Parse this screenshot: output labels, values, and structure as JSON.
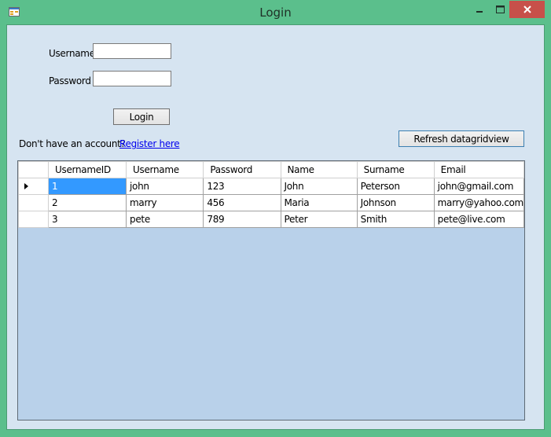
{
  "window": {
    "title": "Login",
    "app_icon": "form-icon",
    "controls": {
      "minimize_icon": "minimize-icon",
      "maximize_icon": "maximize-icon",
      "close_icon": "close-icon"
    },
    "colors": {
      "frame": "#5bbf8c",
      "client": "#d6e4f1",
      "close": "#c7504a",
      "grid_background": "#b9d1ea",
      "selection": "#3399ff"
    }
  },
  "form": {
    "username_label": "Username",
    "username_value": "",
    "password_label": "Password",
    "password_value": "",
    "login_button": "Login",
    "no_account_text": "Don't have an account?",
    "register_link": "Register here",
    "refresh_button": "Refresh datagridview"
  },
  "grid": {
    "columns": [
      "UsernameID",
      "Username",
      "Password",
      "Name",
      "Surname",
      "Email"
    ],
    "rows": [
      [
        "1",
        "john",
        "123",
        "John",
        "Peterson",
        "john@gmail.com"
      ],
      [
        "2",
        "marry",
        "456",
        "Maria",
        "Johnson",
        "marry@yahoo.com"
      ],
      [
        "3",
        "pete",
        "789",
        "Peter",
        "Smith",
        "pete@live.com"
      ]
    ],
    "current_row_indicator": "row-pointer-icon"
  }
}
